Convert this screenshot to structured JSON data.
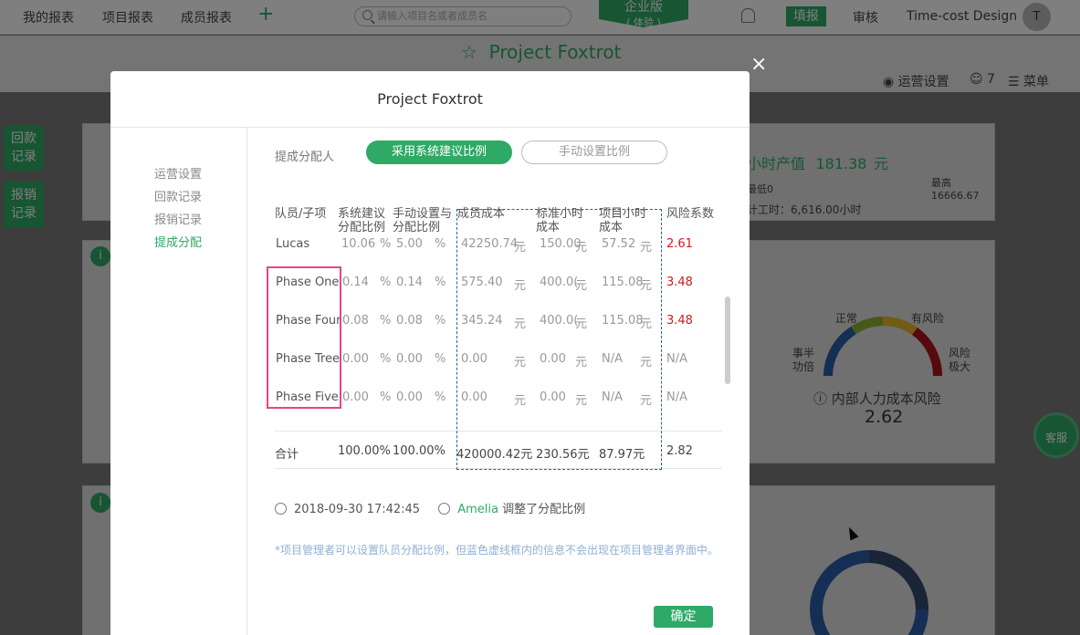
{
  "topbar": {
    "nav": [
      "我的报表",
      "项目报表",
      "成员报表"
    ],
    "add": "+",
    "search_placeholder": "请输入项目名或者成员名",
    "edition": "企业版",
    "edition_sub": "( 体验 )",
    "fill_label": "填报",
    "audit_label": "审核",
    "company": "Time-cost Design",
    "avatar": "T"
  },
  "page": {
    "star": "☆",
    "title": "Project Foxtrot",
    "ops_settings": "运营设置",
    "member_count": "7",
    "menu": "菜单"
  },
  "sidebar_buttons": [
    "回款\n记录",
    "报销\n记录"
  ],
  "background": {
    "hourly_output_label": "小时产值",
    "hourly_output_value": "181.38",
    "hourly_output_unit": "元",
    "min_label": "最低0",
    "max_label": "最高",
    "max_value": "16666.67",
    "total_hours": "计工时：6,616.00小时",
    "gauge_labels": [
      "正常",
      "有风险",
      "事半\n功倍",
      "风险\n极大"
    ],
    "risk_title": "内部人力成本风险",
    "risk_value": "2.62",
    "service": "客服"
  },
  "modal": {
    "title": "Project Foxtrot",
    "close": "×",
    "nav": [
      {
        "label": "运营设置",
        "active": false
      },
      {
        "label": "回款记录",
        "active": false
      },
      {
        "label": "报销记录",
        "active": false
      },
      {
        "label": "提成分配",
        "active": true
      }
    ],
    "allocator_label": "提成分配人",
    "toggle_system": "采用系统建议比例",
    "toggle_manual": "手动设置比例",
    "headers": [
      "队员/子项",
      "系统建议\n分配比例",
      "手动设置与\n分配比例",
      "成员成本",
      "标准小时\n成本",
      "项目小时\n成本",
      "风险系数"
    ],
    "rows": [
      {
        "name": "Lucas",
        "sys": "10.06",
        "sys_unit": "%",
        "man": "5.00",
        "man_unit": "%",
        "cost": "42250.74",
        "cost_unit": "元",
        "std": "150.00",
        "std_unit": "元",
        "proj": "57.52",
        "proj_unit": "元",
        "risk": "2.61",
        "risk_red": true
      },
      {
        "name": "Phase One",
        "sys": "0.14",
        "sys_unit": "%",
        "man": "0.14",
        "man_unit": "%",
        "cost": "575.40",
        "cost_unit": "元",
        "std": "400.0(",
        "std_unit": "元",
        "proj": "115.08",
        "proj_unit": "元",
        "risk": "3.48",
        "risk_red": true
      },
      {
        "name": "Phase Four",
        "sys": "0.08",
        "sys_unit": "%",
        "man": "0.08",
        "man_unit": "%",
        "cost": "345.24",
        "cost_unit": "元",
        "std": "400.0(",
        "std_unit": "元",
        "proj": "115.08",
        "proj_unit": "元",
        "risk": "3.48",
        "risk_red": true
      },
      {
        "name": "Phase Tree",
        "sys": "0.00",
        "sys_unit": "%",
        "man": "0.00",
        "man_unit": "%",
        "cost": "0.00",
        "cost_unit": "元",
        "std": "0.00",
        "std_unit": "元",
        "proj": "N/A",
        "proj_unit": "元",
        "risk": "N/A",
        "risk_red": false
      },
      {
        "name": "Phase Five",
        "sys": "0.00",
        "sys_unit": "%",
        "man": "0.00",
        "man_unit": "%",
        "cost": "0.00",
        "cost_unit": "元",
        "std": "0.00",
        "std_unit": "元",
        "proj": "N/A",
        "proj_unit": "元",
        "risk": "N/A",
        "risk_red": false
      }
    ],
    "total": {
      "label": "合计",
      "sys": "100.00%",
      "man": "100.00%",
      "cost": "420000.42元",
      "std": "230.56元",
      "proj": "87.97元",
      "risk": "2.82"
    },
    "log_time": "2018-09-30 17:42:45",
    "log_user": "Amelia",
    "log_action": "调整了分配比例",
    "note": "*项目管理者可以设置队员分配比例，但蓝色虚线框内的信息不会出现在项目管理者界面中。",
    "ok": "确定"
  },
  "colors": {
    "brand": "#2eaa66",
    "risk_red": "#d01b1b",
    "dashed_blue": "#2a5ea8",
    "highlight": "#e64487"
  }
}
